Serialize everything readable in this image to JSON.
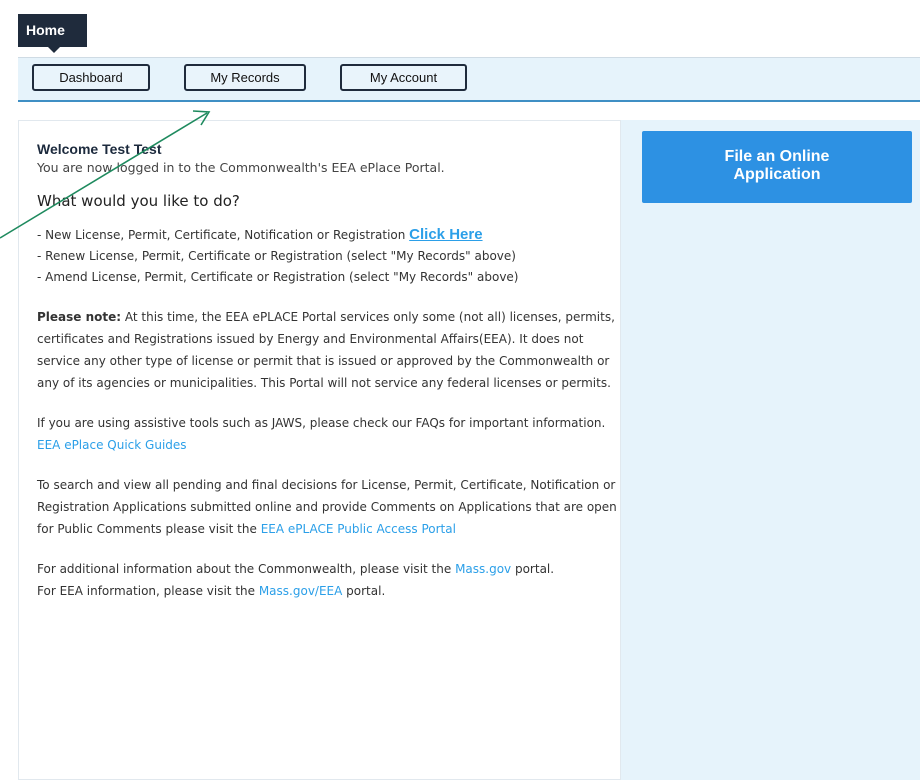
{
  "home_tab": "Home",
  "nav": {
    "dashboard": "Dashboard",
    "my_records": "My Records",
    "my_account": "My Account"
  },
  "side": {
    "file_app_line1": "File an Online",
    "file_app_line2": "Application"
  },
  "welcome": {
    "title": "Welcome Test Test",
    "logged_in": "You are now logged in to the Commonwealth's EEA ePlace Portal."
  },
  "question": "What would you like to do?",
  "options": {
    "new_text": "- New License, Permit, Certificate, Notification or Registration ",
    "new_link": "Click Here",
    "renew": "- Renew License, Permit, Certificate or Registration (select \"My Records\" above)",
    "amend": "- Amend License, Permit, Certificate or Registration (select \"My Records\" above)"
  },
  "note": {
    "label": "Please note:",
    "text": " At this time, the EEA ePLACE Portal services only some (not all) licenses, permits, certificates and Registrations issued by Energy and Environmental Affairs(EEA). It does not service any other type of license or permit that is issued or approved by the Commonwealth or any of its agencies or municipalities. This Portal will not service any federal licenses or permits."
  },
  "assistive": {
    "text": "If you are using assistive tools such as JAWS, please check our FAQs for important information. ",
    "link": "EEA ePlace Quick Guides"
  },
  "search": {
    "text": "To search and view all pending and final decisions for License, Permit, Certificate, Notification or Registration Applications submitted online and provide Comments on Applications that are open for Public Comments please visit the ",
    "link": "EEA ePLACE Public Access Portal"
  },
  "additional": {
    "text1": "For additional information about the Commonwealth, please visit the ",
    "link1": "Mass.gov",
    "text1b": " portal.",
    "text2": "For EEA information, please visit the ",
    "link2": "Mass.gov/EEA",
    "text2b": " portal."
  },
  "colors": {
    "accent": "#2d91e3",
    "link": "#2b9fe8",
    "nav_bg": "#e6f3fb",
    "dark": "#1f2b3c",
    "annotation_arrow": "#1e8a5e"
  }
}
